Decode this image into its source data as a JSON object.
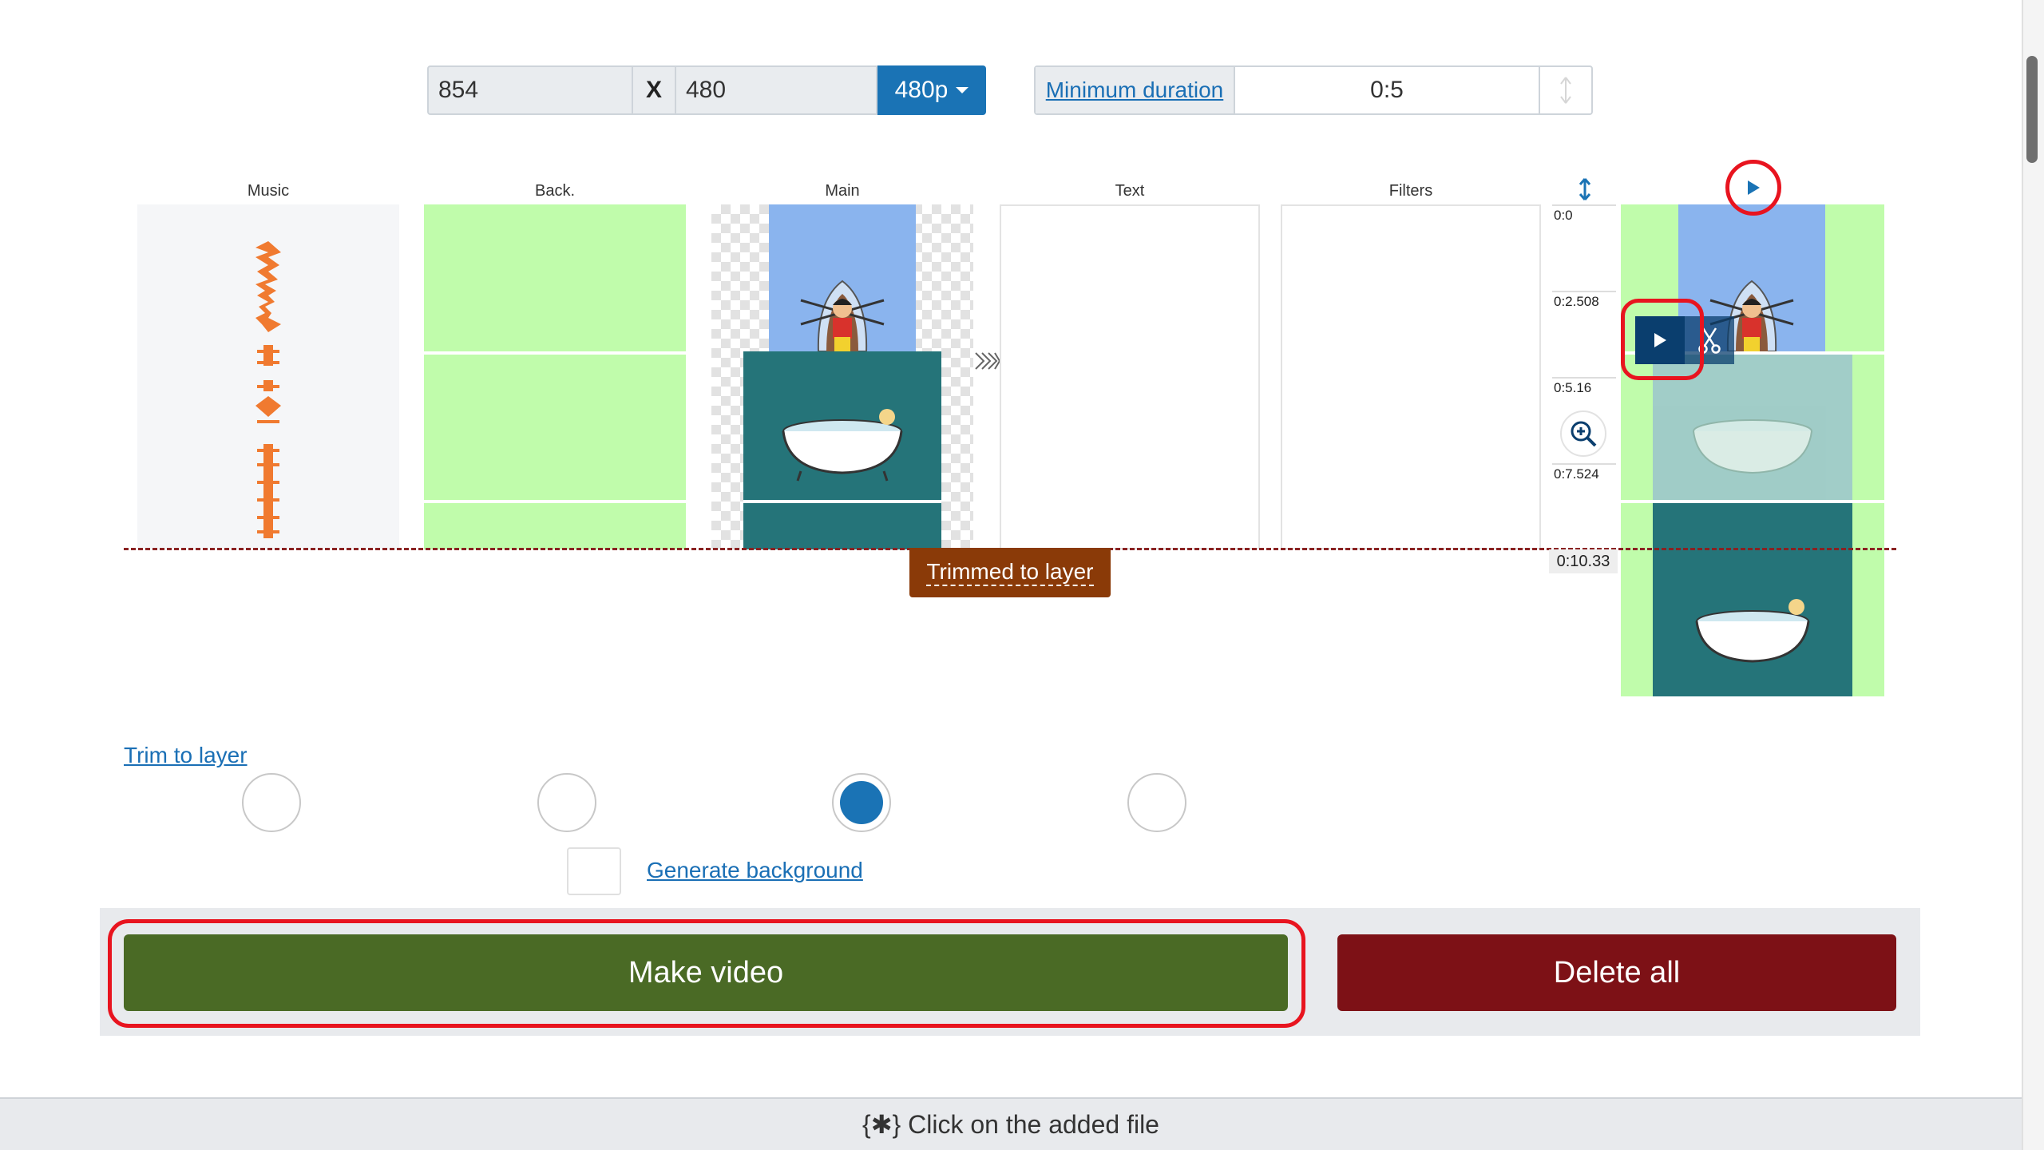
{
  "resolution": {
    "width": "854",
    "separator": "X",
    "height": "480",
    "preset": "480p"
  },
  "duration": {
    "label": "Minimum duration",
    "value": "0:5"
  },
  "layers": {
    "music": "Music",
    "back": "Back.",
    "main": "Main",
    "text": "Text",
    "filters": "Filters"
  },
  "timeline": {
    "t0": "0:0",
    "t1": "0:2.508",
    "t2": "0:5.16",
    "t3": "0:7.524",
    "end": "0:10.33"
  },
  "trim_badge": "Trimmed to layer",
  "trim_link": "Trim to layer",
  "generate_background": "Generate background",
  "actions": {
    "make_video": "Make video",
    "delete_all": "Delete all"
  },
  "footer_hint": "{✱} Click on the added file",
  "colors": {
    "accent": "#1a73b5",
    "make": "#4a6a25",
    "delete": "#7d1116",
    "highlight": "#e8141f",
    "green_layer": "#c0fcab"
  }
}
